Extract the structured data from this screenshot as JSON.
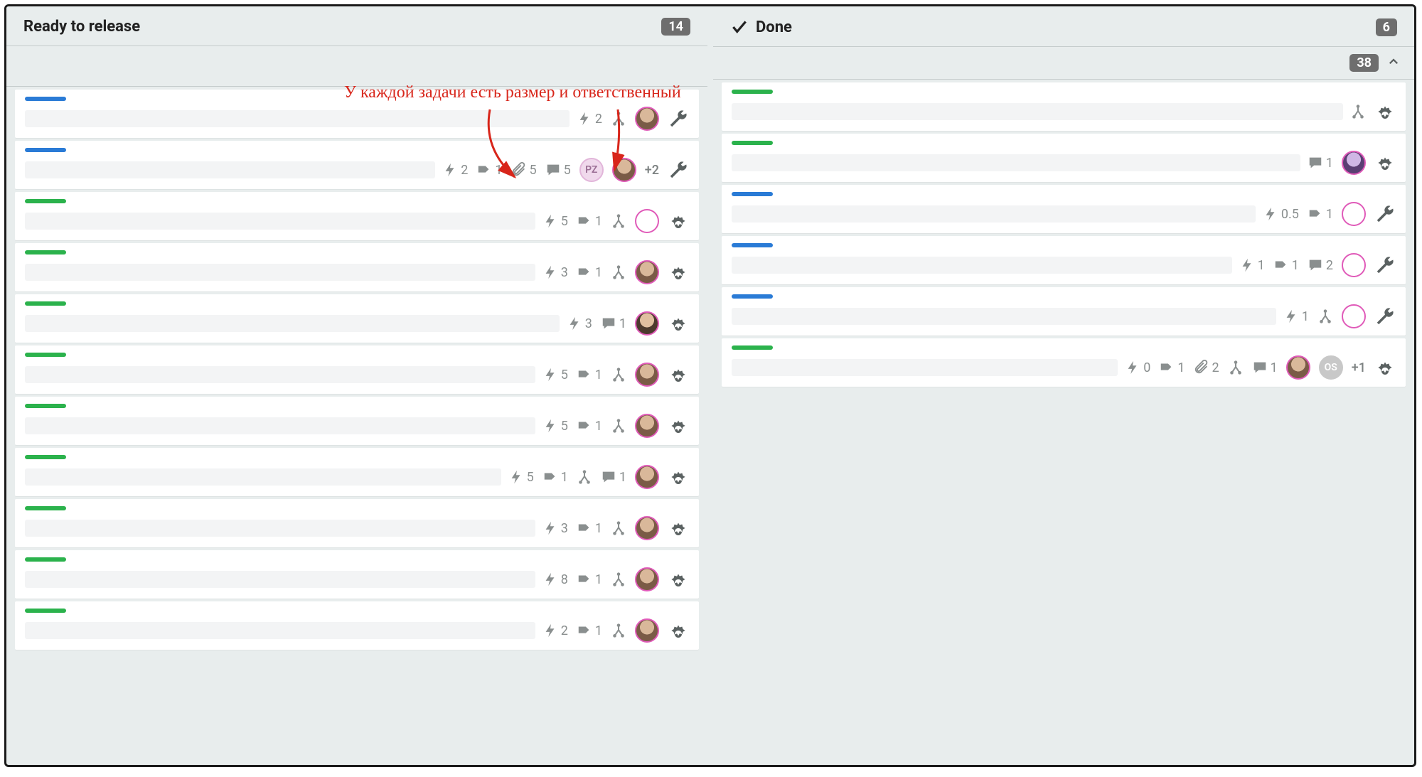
{
  "annotation": {
    "text": "У каждой задачи есть размер и ответственный"
  },
  "swimlane": {
    "total_badge": "38"
  },
  "columns": [
    {
      "id": "ready",
      "title": "Ready to release",
      "count": "14",
      "cards": [
        {
          "color": "blue",
          "bolt": "2",
          "tag": null,
          "clip": null,
          "chat": null,
          "merge": true,
          "avatars": [
            {
              "type": "photo"
            }
          ],
          "plus": null,
          "action": "wrench"
        },
        {
          "color": "blue",
          "bolt": "2",
          "tag": "1",
          "clip": "5",
          "chat": "5",
          "merge": false,
          "avatars": [
            {
              "type": "pz",
              "label": "PZ"
            },
            {
              "type": "photo"
            }
          ],
          "plus": "+2",
          "action": "wrench"
        },
        {
          "color": "green",
          "bolt": "5",
          "tag": "1",
          "clip": null,
          "chat": null,
          "merge": true,
          "avatars": [
            {
              "type": "empty"
            }
          ],
          "plus": null,
          "action": "gear"
        },
        {
          "color": "green",
          "bolt": "3",
          "tag": "1",
          "clip": null,
          "chat": null,
          "merge": true,
          "avatars": [
            {
              "type": "photo"
            }
          ],
          "plus": null,
          "action": "gear"
        },
        {
          "color": "green",
          "bolt": "3",
          "tag": null,
          "clip": null,
          "chat": "1",
          "merge": false,
          "avatars": [
            {
              "type": "photo2"
            }
          ],
          "plus": null,
          "action": "gear"
        },
        {
          "color": "green",
          "bolt": "5",
          "tag": "1",
          "clip": null,
          "chat": null,
          "merge": true,
          "avatars": [
            {
              "type": "photo"
            }
          ],
          "plus": null,
          "action": "gear"
        },
        {
          "color": "green",
          "bolt": "5",
          "tag": "1",
          "clip": null,
          "chat": null,
          "merge": true,
          "avatars": [
            {
              "type": "photo"
            }
          ],
          "plus": null,
          "action": "gear"
        },
        {
          "color": "green",
          "bolt": "5",
          "tag": "1",
          "clip": null,
          "chat": "1",
          "merge": true,
          "avatars": [
            {
              "type": "photo"
            }
          ],
          "plus": null,
          "action": "gear"
        },
        {
          "color": "green",
          "bolt": "3",
          "tag": "1",
          "clip": null,
          "chat": null,
          "merge": true,
          "avatars": [
            {
              "type": "photo"
            }
          ],
          "plus": null,
          "action": "gear"
        },
        {
          "color": "green",
          "bolt": "8",
          "tag": "1",
          "clip": null,
          "chat": null,
          "merge": true,
          "avatars": [
            {
              "type": "photo"
            }
          ],
          "plus": null,
          "action": "gear"
        },
        {
          "color": "green",
          "bolt": "2",
          "tag": "1",
          "clip": null,
          "chat": null,
          "merge": true,
          "avatars": [
            {
              "type": "photo"
            }
          ],
          "plus": null,
          "action": "gear"
        }
      ]
    },
    {
      "id": "done",
      "title": "Done",
      "count": "6",
      "cards": [
        {
          "color": "green",
          "bolt": null,
          "tag": null,
          "clip": null,
          "chat": null,
          "merge": true,
          "avatars": [],
          "plus": null,
          "action": "gear"
        },
        {
          "color": "green",
          "bolt": null,
          "tag": null,
          "clip": null,
          "chat": "1",
          "merge": false,
          "avatars": [
            {
              "type": "photo3"
            }
          ],
          "plus": null,
          "action": "gear"
        },
        {
          "color": "blue",
          "bolt": "0.5",
          "tag": "1",
          "clip": null,
          "chat": null,
          "merge": false,
          "avatars": [
            {
              "type": "empty"
            }
          ],
          "plus": null,
          "action": "wrench"
        },
        {
          "color": "blue",
          "bolt": "1",
          "tag": "1",
          "clip": null,
          "chat": "2",
          "merge": false,
          "avatars": [
            {
              "type": "empty"
            }
          ],
          "plus": null,
          "action": "wrench"
        },
        {
          "color": "blue",
          "bolt": "1",
          "tag": null,
          "clip": null,
          "chat": null,
          "merge": true,
          "avatars": [
            {
              "type": "empty"
            }
          ],
          "plus": null,
          "action": "wrench"
        },
        {
          "color": "green",
          "bolt": "0",
          "tag": "1",
          "clip": "2",
          "chat": "1",
          "merge": true,
          "avatars": [
            {
              "type": "photo"
            },
            {
              "type": "gray",
              "label": "OS"
            }
          ],
          "plus": "+1",
          "action": "gear"
        }
      ]
    }
  ]
}
